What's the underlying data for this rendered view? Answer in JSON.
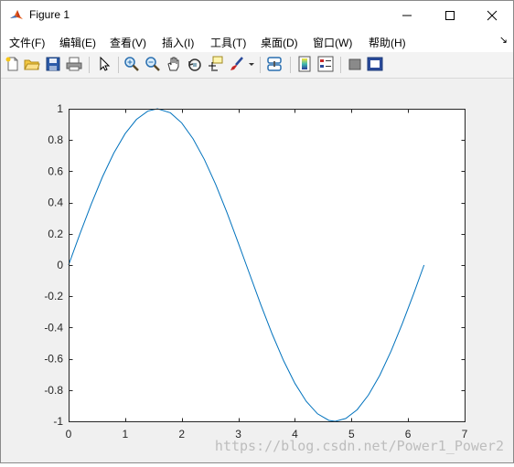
{
  "window": {
    "title": "Figure 1",
    "controls": {
      "minimize": "minimize",
      "maximize": "maximize",
      "close": "close"
    }
  },
  "menubar": {
    "items": [
      "文件(F)",
      "编辑(E)",
      "查看(V)",
      "插入(I)",
      "工具(T)",
      "桌面(D)",
      "窗口(W)",
      "帮助(H)"
    ],
    "overflow_arrow": "↘"
  },
  "toolbar": {
    "icons": [
      "new-figure-icon",
      "open-file-icon",
      "save-icon",
      "print-icon",
      "edit-plot-arrow-icon",
      "zoom-in-icon",
      "zoom-out-icon",
      "pan-hand-icon",
      "rotate-3d-icon",
      "data-cursor-icon",
      "brush-icon",
      "link-plot-icon",
      "colorbar-icon",
      "legend-icon",
      "hide-plot-tools-icon",
      "show-plot-tools-icon"
    ]
  },
  "watermark": "https://blog.csdn.net/Power1_Power2",
  "chart_data": {
    "type": "line",
    "title": "",
    "xlabel": "",
    "ylabel": "",
    "xlim": [
      0,
      7
    ],
    "ylim": [
      -1,
      1
    ],
    "xticks": [
      0,
      1,
      2,
      3,
      4,
      5,
      6,
      7
    ],
    "yticks": [
      -1,
      -0.8,
      -0.6,
      -0.4,
      -0.2,
      0,
      0.2,
      0.4,
      0.6,
      0.8,
      1
    ],
    "xtick_labels": [
      "0",
      "1",
      "2",
      "3",
      "4",
      "5",
      "6",
      "7"
    ],
    "ytick_labels": [
      "-1",
      "-0.8",
      "-0.6",
      "-0.4",
      "-0.2",
      "0",
      "0.2",
      "0.4",
      "0.6",
      "0.8",
      "1"
    ],
    "grid": false,
    "series": [
      {
        "color": "#0072bd",
        "x": [
          0,
          0.2,
          0.4,
          0.6,
          0.8,
          1.0,
          1.2,
          1.4,
          1.5708,
          1.8,
          2.0,
          2.2,
          2.4,
          2.6,
          2.8,
          3.0,
          3.1416,
          3.4,
          3.6,
          3.8,
          4.0,
          4.2,
          4.4,
          4.6,
          4.7124,
          4.9,
          5.1,
          5.3,
          5.5,
          5.7,
          5.9,
          6.1,
          6.2832
        ],
        "y": [
          0,
          0.199,
          0.389,
          0.565,
          0.717,
          0.841,
          0.932,
          0.985,
          1.0,
          0.974,
          0.909,
          0.808,
          0.675,
          0.516,
          0.335,
          0.141,
          0,
          -0.256,
          -0.443,
          -0.612,
          -0.757,
          -0.872,
          -0.952,
          -0.994,
          -1.0,
          -0.982,
          -0.926,
          -0.832,
          -0.706,
          -0.551,
          -0.374,
          -0.183,
          0
        ]
      }
    ]
  }
}
